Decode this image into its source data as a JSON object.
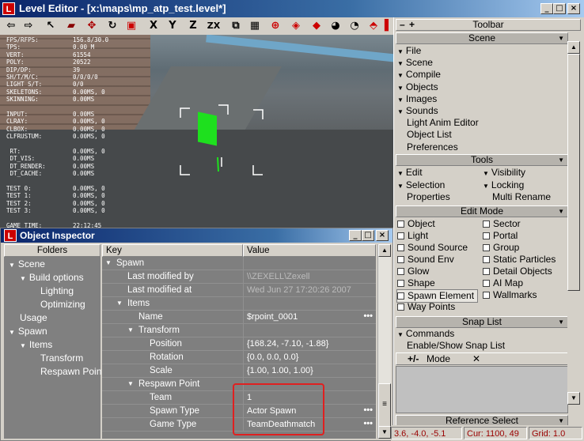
{
  "window": {
    "title": "Level Editor - [x:\\maps\\mp_atp_test.level*]",
    "app_icon": "L"
  },
  "viewport_stats": [
    {
      "k": "FPS/RFPS:",
      "v": "156.8/30.0"
    },
    {
      "k": "TPS:",
      "v": "0.00 M"
    },
    {
      "k": "VERT:",
      "v": "61554"
    },
    {
      "k": "POLY:",
      "v": "20522"
    },
    {
      "k": "DIP/DP:",
      "v": "39"
    },
    {
      "k": "SH/T/M/C:",
      "v": "0/0/0/0"
    },
    {
      "k": "LIGHT S/T:",
      "v": "0/0"
    },
    {
      "k": "SKELETONS:",
      "v": "0.00MS, 0"
    },
    {
      "k": "SKINNING:",
      "v": "0.00MS"
    },
    {
      "k": "",
      "v": ""
    },
    {
      "k": "INPUT:",
      "v": "0.00MS"
    },
    {
      "k": "CLRAY:",
      "v": "0.00MS, 0"
    },
    {
      "k": "CLBOX:",
      "v": "0.00MS, 0"
    },
    {
      "k": "CLFRUSTUM:",
      "v": "0.00MS, 0"
    },
    {
      "k": "",
      "v": ""
    },
    {
      "k": " RT:",
      "v": "0.00MS, 0"
    },
    {
      "k": " DT_VIS:",
      "v": "0.00MS"
    },
    {
      "k": " DT_RENDER:",
      "v": "0.00MS"
    },
    {
      "k": " DT_CACHE:",
      "v": "0.00MS"
    },
    {
      "k": "",
      "v": ""
    },
    {
      "k": "TEST 0:",
      "v": "0.00MS, 0"
    },
    {
      "k": "TEST 1:",
      "v": "0.00MS, 0"
    },
    {
      "k": "TEST 2:",
      "v": "0.00MS, 0"
    },
    {
      "k": "TEST 3:",
      "v": "0.00MS, 0"
    },
    {
      "k": "",
      "v": ""
    },
    {
      "k": "GAME TIME:",
      "v": "22:12:45"
    }
  ],
  "inspector": {
    "title": "Object Inspector",
    "folders_header": "Folders",
    "folders": [
      {
        "label": "Scene",
        "level": 0,
        "expanded": true
      },
      {
        "label": "Build options",
        "level": 1,
        "expanded": true
      },
      {
        "label": "Lighting",
        "level": 2
      },
      {
        "label": "Optimizing",
        "level": 2
      },
      {
        "label": "Usage",
        "level": 1
      },
      {
        "label": "Spawn",
        "level": 0,
        "expanded": true
      },
      {
        "label": "Items",
        "level": 1,
        "expanded": true
      },
      {
        "label": "Transform",
        "level": 2
      },
      {
        "label": "Respawn Point",
        "level": 2
      }
    ],
    "key_header": "Key",
    "value_header": "Value",
    "rows": [
      {
        "key": "Spawn",
        "value": "",
        "level": 0,
        "expander": true
      },
      {
        "key": "Last modified by",
        "value": "\\\\ZEXELL\\Zexell",
        "level": 1,
        "dim": true
      },
      {
        "key": "Last modified at",
        "value": "Wed Jun 27 17:20:26 2007",
        "level": 1,
        "dim": true
      },
      {
        "key": "Items",
        "value": "",
        "level": 1,
        "expander": true
      },
      {
        "key": "Name",
        "value": "$rpoint_0001",
        "level": 2,
        "dots": true
      },
      {
        "key": "Transform",
        "value": "",
        "level": 2,
        "expander": true
      },
      {
        "key": "Position",
        "value": "{168.24, -7.10, -1.88}",
        "level": 3
      },
      {
        "key": "Rotation",
        "value": "{0.0, 0.0, 0.0}",
        "level": 3
      },
      {
        "key": "Scale",
        "value": "{1.00, 1.00, 1.00}",
        "level": 3
      },
      {
        "key": "Respawn Point",
        "value": "",
        "level": 2,
        "expander": true
      },
      {
        "key": "Team",
        "value": "1",
        "level": 3
      },
      {
        "key": "Spawn Type",
        "value": "Actor Spawn",
        "level": 3,
        "dots": true
      },
      {
        "key": "Game Type",
        "value": "TeamDeathmatch",
        "level": 3,
        "dots": true
      }
    ]
  },
  "panel": {
    "toolbar_header": "Toolbar",
    "scene_header": "Scene",
    "scene_items": [
      {
        "label": "File",
        "arrow": true
      },
      {
        "label": "Scene",
        "arrow": true
      },
      {
        "label": "Compile",
        "arrow": true
      },
      {
        "label": "Objects",
        "arrow": true
      },
      {
        "label": "Images",
        "arrow": true
      },
      {
        "label": "Sounds",
        "arrow": true
      },
      {
        "label": "Light Anim Editor"
      },
      {
        "label": "Object List"
      },
      {
        "label": "Preferences"
      }
    ],
    "tools_header": "Tools",
    "tools_left": [
      {
        "label": "Edit",
        "arrow": true
      },
      {
        "label": "Selection",
        "arrow": true
      },
      {
        "label": "Properties"
      }
    ],
    "tools_right": [
      {
        "label": "Visibility",
        "arrow": true
      },
      {
        "label": "Locking",
        "arrow": true
      },
      {
        "label": "Multi Rename"
      }
    ],
    "editmode_header": "Edit Mode",
    "editmode_left": [
      "Object",
      "Light",
      "Sound Source",
      "Sound Env",
      "Glow",
      "Shape",
      "Spawn Element",
      "Way Points"
    ],
    "editmode_right": [
      "Sector",
      "Portal",
      "Group",
      "Static Particles",
      "Detail Objects",
      "AI Map",
      "Wallmarks"
    ],
    "editmode_active": "Spawn Element",
    "snaplist_header": "Snap List",
    "commands_label": "Commands",
    "snap_toggle": "Enable/Show Snap List",
    "mode_plusminus": "+/-",
    "mode_label": "Mode",
    "mode_close": "✕",
    "refselect_header": "Reference Select"
  },
  "status": {
    "coords": "3.6, -4.0, -5.1",
    "cursor": "Cur: 1100, 49",
    "grid": "Grid: 1.0"
  }
}
